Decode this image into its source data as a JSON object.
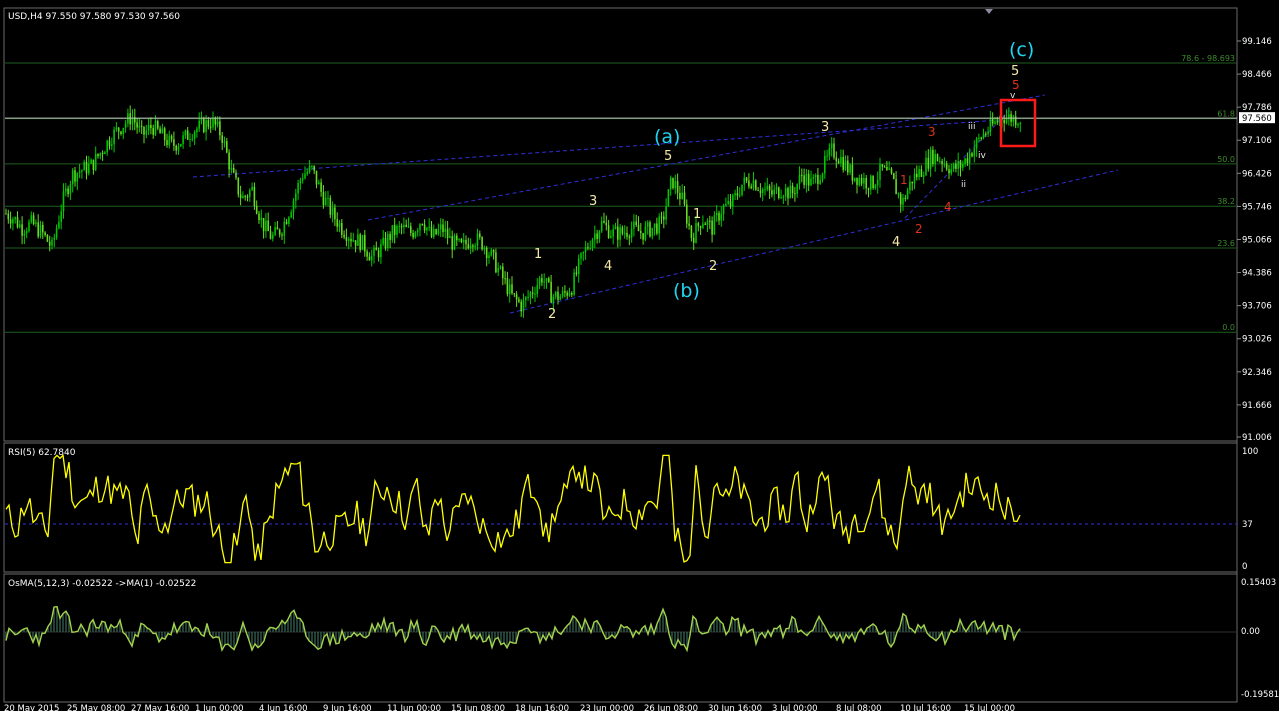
{
  "header": {
    "symbol_info": "USD,H4  97.550 97.580 97.530 97.560",
    "rsi_title": "RSI(5) 62.7840",
    "osma_title": "OsMA(5,12,3) -0.02522  ->MA(1) -0.02522"
  },
  "colors": {
    "background": "#000000",
    "candle_up": "#00c800",
    "candle_down": "#66dd22",
    "grid_green": "#1f5e1f",
    "channel_blue": "#2f2fd8",
    "rsi_line": "#ffff00",
    "osma_line": "#a4d24a",
    "osma_hist": "#3b6b5a",
    "highlight_box": "#ff1a1a",
    "current_price_line": "#c0c0c0"
  },
  "axes": {
    "price_ticks": [
      "99.146",
      "98.466",
      "97.786",
      "97.106",
      "96.426",
      "95.746",
      "95.066",
      "94.386",
      "93.706",
      "93.026",
      "92.346",
      "91.666",
      "91.006"
    ],
    "current_price": "97.560",
    "rsi_ticks": [
      "100",
      "37",
      "0"
    ],
    "osma_ticks": [
      "0.15403",
      "0.00",
      "-0.19581"
    ],
    "date_ticks": [
      "20 May 2015",
      "25 May 08:00",
      "27 May 16:00",
      "1 Jun 00:00",
      "4 Jun 16:00",
      "9 Jun 16:00",
      "11 Jun 00:00",
      "15 Jun 08:00",
      "18 Jun 16:00",
      "23 Jun 00:00",
      "26 Jun 08:00",
      "30 Jun 16:00",
      "3 Jul 00:00",
      "8 Jul 08:00",
      "10 Jul 16:00",
      "15 Jul 00:00"
    ]
  },
  "fib_levels": [
    {
      "label": "78.6 - 98.693",
      "price": 98.693
    },
    {
      "label": "61.8",
      "price": 97.55
    },
    {
      "label": "50.0",
      "price": 96.62
    },
    {
      "label": "38.2",
      "price": 95.75
    },
    {
      "label": "23.6",
      "price": 94.89
    },
    {
      "label": "0.0",
      "price": 93.16
    }
  ],
  "wave_labels": {
    "main": [
      "1",
      "2",
      "3",
      "4",
      "5",
      "1",
      "2",
      "3",
      "4",
      "5"
    ],
    "sub": [
      "1",
      "2",
      "3",
      "4",
      "5"
    ],
    "minor": [
      "ii",
      "iii",
      "iv",
      "v"
    ],
    "corrective": [
      "(a)",
      "(b)",
      "(c)"
    ]
  },
  "chart_data": {
    "type": "candlestick",
    "price_range": [
      91.006,
      99.146
    ],
    "series": [
      {
        "name": "USD,H4",
        "close_path": [
          [
            0,
            95.6
          ],
          [
            8,
            95.5
          ],
          [
            16,
            95.3
          ],
          [
            26,
            95.4
          ],
          [
            36,
            95.2
          ],
          [
            46,
            94.9
          ],
          [
            56,
            95.8
          ],
          [
            66,
            96.4
          ],
          [
            76,
            96.5
          ],
          [
            86,
            96.6
          ],
          [
            96,
            96.9
          ],
          [
            106,
            97.2
          ],
          [
            116,
            97.4
          ],
          [
            126,
            97.6
          ],
          [
            136,
            97.2
          ],
          [
            146,
            97.4
          ],
          [
            156,
            97.2
          ],
          [
            166,
            97.0
          ],
          [
            176,
            97.1
          ],
          [
            186,
            97.3
          ],
          [
            196,
            97.4
          ],
          [
            206,
            97.5
          ],
          [
            216,
            97.2
          ],
          [
            226,
            96.4
          ],
          [
            236,
            95.9
          ],
          [
            246,
            96.1
          ],
          [
            256,
            95.4
          ],
          [
            266,
            95.1
          ],
          [
            276,
            95.3
          ],
          [
            286,
            95.8
          ],
          [
            296,
            96.4
          ],
          [
            306,
            96.5
          ],
          [
            316,
            96.0
          ],
          [
            326,
            95.6
          ],
          [
            336,
            95.3
          ],
          [
            346,
            95.1
          ],
          [
            356,
            95.0
          ],
          [
            366,
            94.7
          ],
          [
            376,
            94.9
          ],
          [
            386,
            95.2
          ],
          [
            396,
            95.3
          ],
          [
            406,
            95.2
          ],
          [
            416,
            95.5
          ],
          [
            426,
            95.1
          ],
          [
            436,
            95.3
          ],
          [
            446,
            95.0
          ],
          [
            456,
            94.9
          ],
          [
            466,
            95.1
          ],
          [
            476,
            95.0
          ],
          [
            486,
            94.7
          ],
          [
            496,
            94.3
          ],
          [
            506,
            93.9
          ],
          [
            516,
            93.7
          ],
          [
            526,
            94.0
          ],
          [
            536,
            94.3
          ],
          [
            546,
            93.9
          ],
          [
            556,
            93.9
          ],
          [
            566,
            94.1
          ],
          [
            576,
            94.7
          ],
          [
            586,
            95.1
          ],
          [
            596,
            95.4
          ],
          [
            606,
            95.2
          ],
          [
            616,
            95.2
          ],
          [
            626,
            95.3
          ],
          [
            636,
            95.2
          ],
          [
            646,
            95.3
          ],
          [
            656,
            95.4
          ],
          [
            666,
            96.3
          ],
          [
            676,
            95.9
          ],
          [
            686,
            95.1
          ],
          [
            696,
            95.5
          ],
          [
            706,
            95.3
          ],
          [
            716,
            95.7
          ],
          [
            726,
            95.8
          ],
          [
            736,
            96.2
          ],
          [
            746,
            96.3
          ],
          [
            756,
            96.1
          ],
          [
            766,
            96.0
          ],
          [
            776,
            96.1
          ],
          [
            786,
            96.0
          ],
          [
            796,
            96.4
          ],
          [
            806,
            96.2
          ],
          [
            816,
            96.5
          ],
          [
            826,
            96.9
          ],
          [
            836,
            96.7
          ],
          [
            846,
            96.4
          ],
          [
            856,
            96.3
          ],
          [
            866,
            96.2
          ],
          [
            876,
            96.5
          ],
          [
            886,
            96.3
          ],
          [
            896,
            95.8
          ],
          [
            906,
            96.3
          ],
          [
            916,
            96.5
          ],
          [
            926,
            96.8
          ],
          [
            936,
            96.7
          ],
          [
            946,
            96.5
          ],
          [
            956,
            96.6
          ],
          [
            966,
            96.9
          ],
          [
            976,
            97.2
          ],
          [
            986,
            97.4
          ],
          [
            996,
            97.6
          ],
          [
            1006,
            97.56
          ],
          [
            1016,
            97.56
          ]
        ]
      }
    ]
  }
}
